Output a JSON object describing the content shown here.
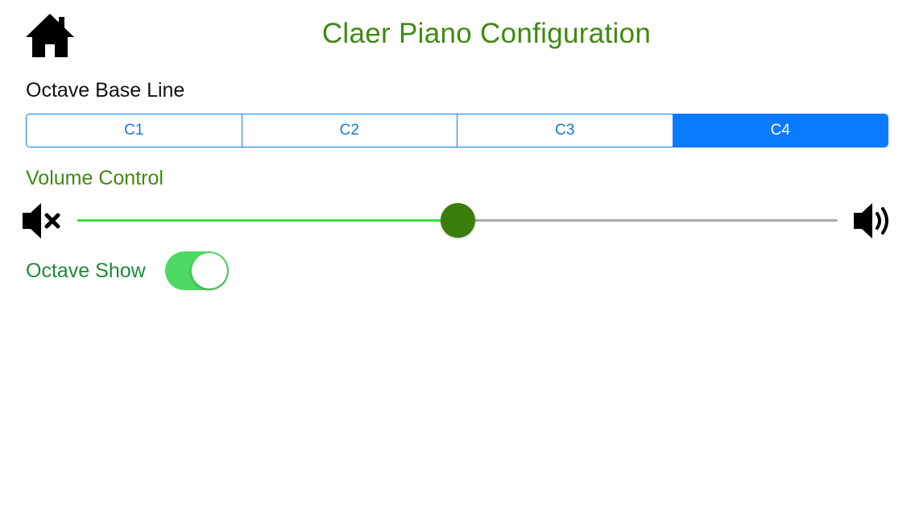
{
  "header": {
    "title": "Claer Piano Configuration",
    "home_icon": "home-icon",
    "title_color": "#3f8a12"
  },
  "octave_base_line": {
    "label": "Octave Base Line",
    "options": [
      "C1",
      "C2",
      "C3",
      "C4"
    ],
    "selected": "C4",
    "accent_color": "#0a7bff"
  },
  "volume_control": {
    "label": "Volume Control",
    "value_fraction": 0.5,
    "min_icon": "volume-mute-icon",
    "max_icon": "volume-high-icon",
    "fill_color": "#35e33a",
    "thumb_color": "#3a7d0a"
  },
  "octave_show": {
    "label": "Octave Show",
    "on": true,
    "toggle_color": "#4cd964"
  }
}
